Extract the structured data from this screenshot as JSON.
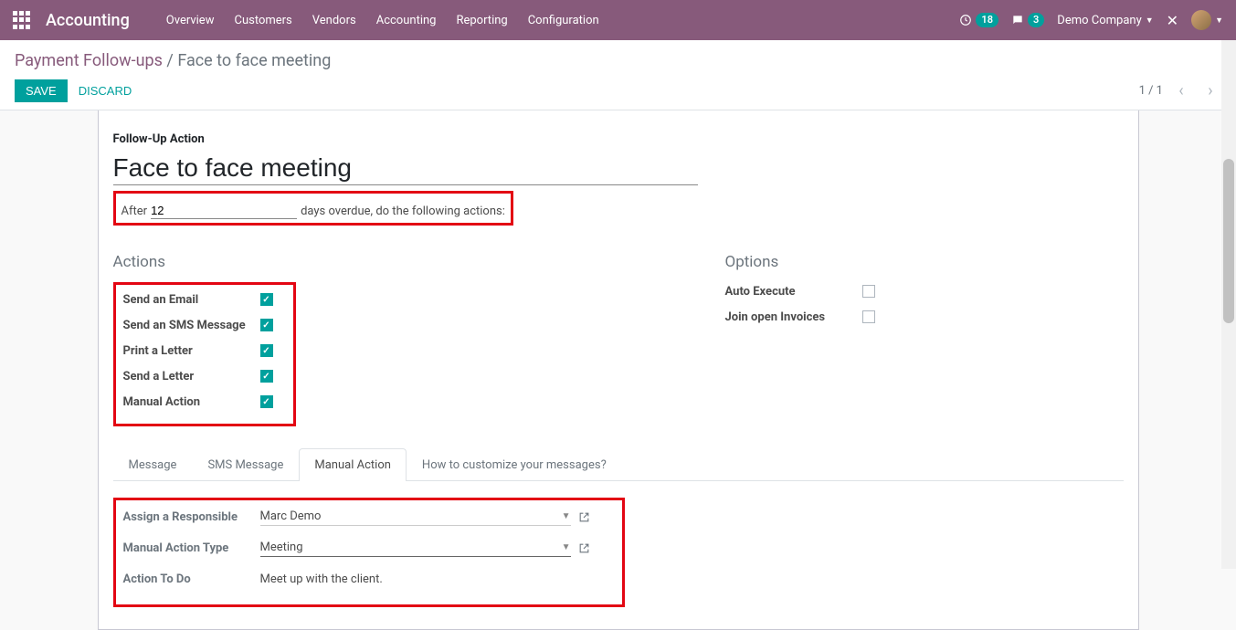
{
  "nav": {
    "brand": "Accounting",
    "menu": [
      "Overview",
      "Customers",
      "Vendors",
      "Accounting",
      "Reporting",
      "Configuration"
    ],
    "clock_badge": "18",
    "chat_badge": "3",
    "company": "Demo Company"
  },
  "breadcrumb": {
    "parent": "Payment Follow-ups",
    "sep": "/",
    "current": "Face to face meeting"
  },
  "buttons": {
    "save": "SAVE",
    "discard": "DISCARD"
  },
  "pager": {
    "text": "1 / 1"
  },
  "form": {
    "section_label": "Follow-Up Action",
    "title": "Face to face meeting",
    "after_prefix": "After",
    "days": "12",
    "after_suffix": "days overdue, do the following actions:",
    "actions_title": "Actions",
    "options_title": "Options",
    "actions": [
      {
        "label": "Send an Email",
        "checked": true
      },
      {
        "label": "Send an SMS Message",
        "checked": true
      },
      {
        "label": "Print a Letter",
        "checked": true
      },
      {
        "label": "Send a Letter",
        "checked": true
      },
      {
        "label": "Manual Action",
        "checked": true
      }
    ],
    "options": [
      {
        "label": "Auto Execute",
        "checked": false
      },
      {
        "label": "Join open Invoices",
        "checked": false
      }
    ],
    "tabs": [
      "Message",
      "SMS Message",
      "Manual Action",
      "How to customize your messages?"
    ],
    "active_tab": 2,
    "manual_action": {
      "responsible_label": "Assign a Responsible",
      "responsible_value": "Marc Demo",
      "type_label": "Manual Action Type",
      "type_value": "Meeting",
      "todo_label": "Action To Do",
      "todo_value": "Meet up with the client."
    }
  }
}
